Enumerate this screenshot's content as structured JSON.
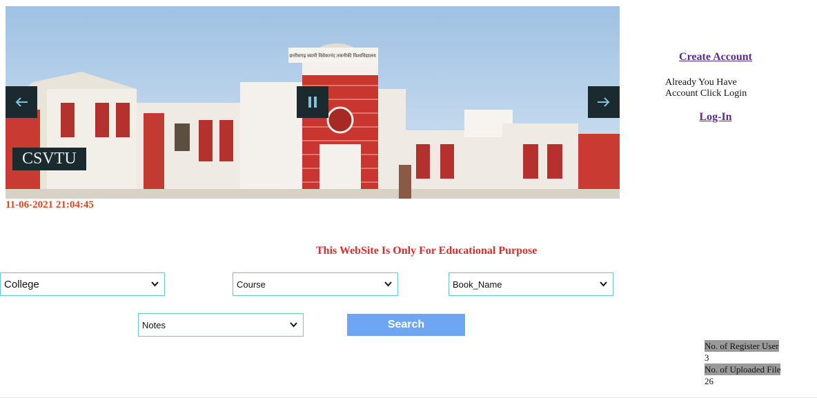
{
  "slider": {
    "caption": "CSVTU",
    "building_sign": "छत्तीसगढ़ स्वामी विवेकानंद तकनीकी विश्वविद्यालय",
    "prev_icon": "arrow-left-icon",
    "next_icon": "arrow-right-icon",
    "pause_icon": "pause-icon"
  },
  "timestamp": "11-06-2021 21:04:45",
  "account": {
    "create_label": "Create Account",
    "already_text": "Already You Have Account Click Login",
    "login_label": "Log-In"
  },
  "notice": "This WebSite Is Only For Educational Purpose",
  "filters": {
    "college": "College",
    "course": "Course",
    "book_name": "Book_Name",
    "notes": "Notes"
  },
  "search_label": "Search",
  "stats": {
    "register_label": "No. of Register User",
    "register_count": "3",
    "uploaded_label": "No. of Uploaded File",
    "uploaded_count": "26"
  },
  "colors": {
    "timestamp": "#e0451f",
    "notice": "#e02a2a",
    "link": "#5a2a8e",
    "search_button": "#6ea6f3",
    "select_border": "#60c8d8",
    "slider_control": "#1b2a2f"
  }
}
